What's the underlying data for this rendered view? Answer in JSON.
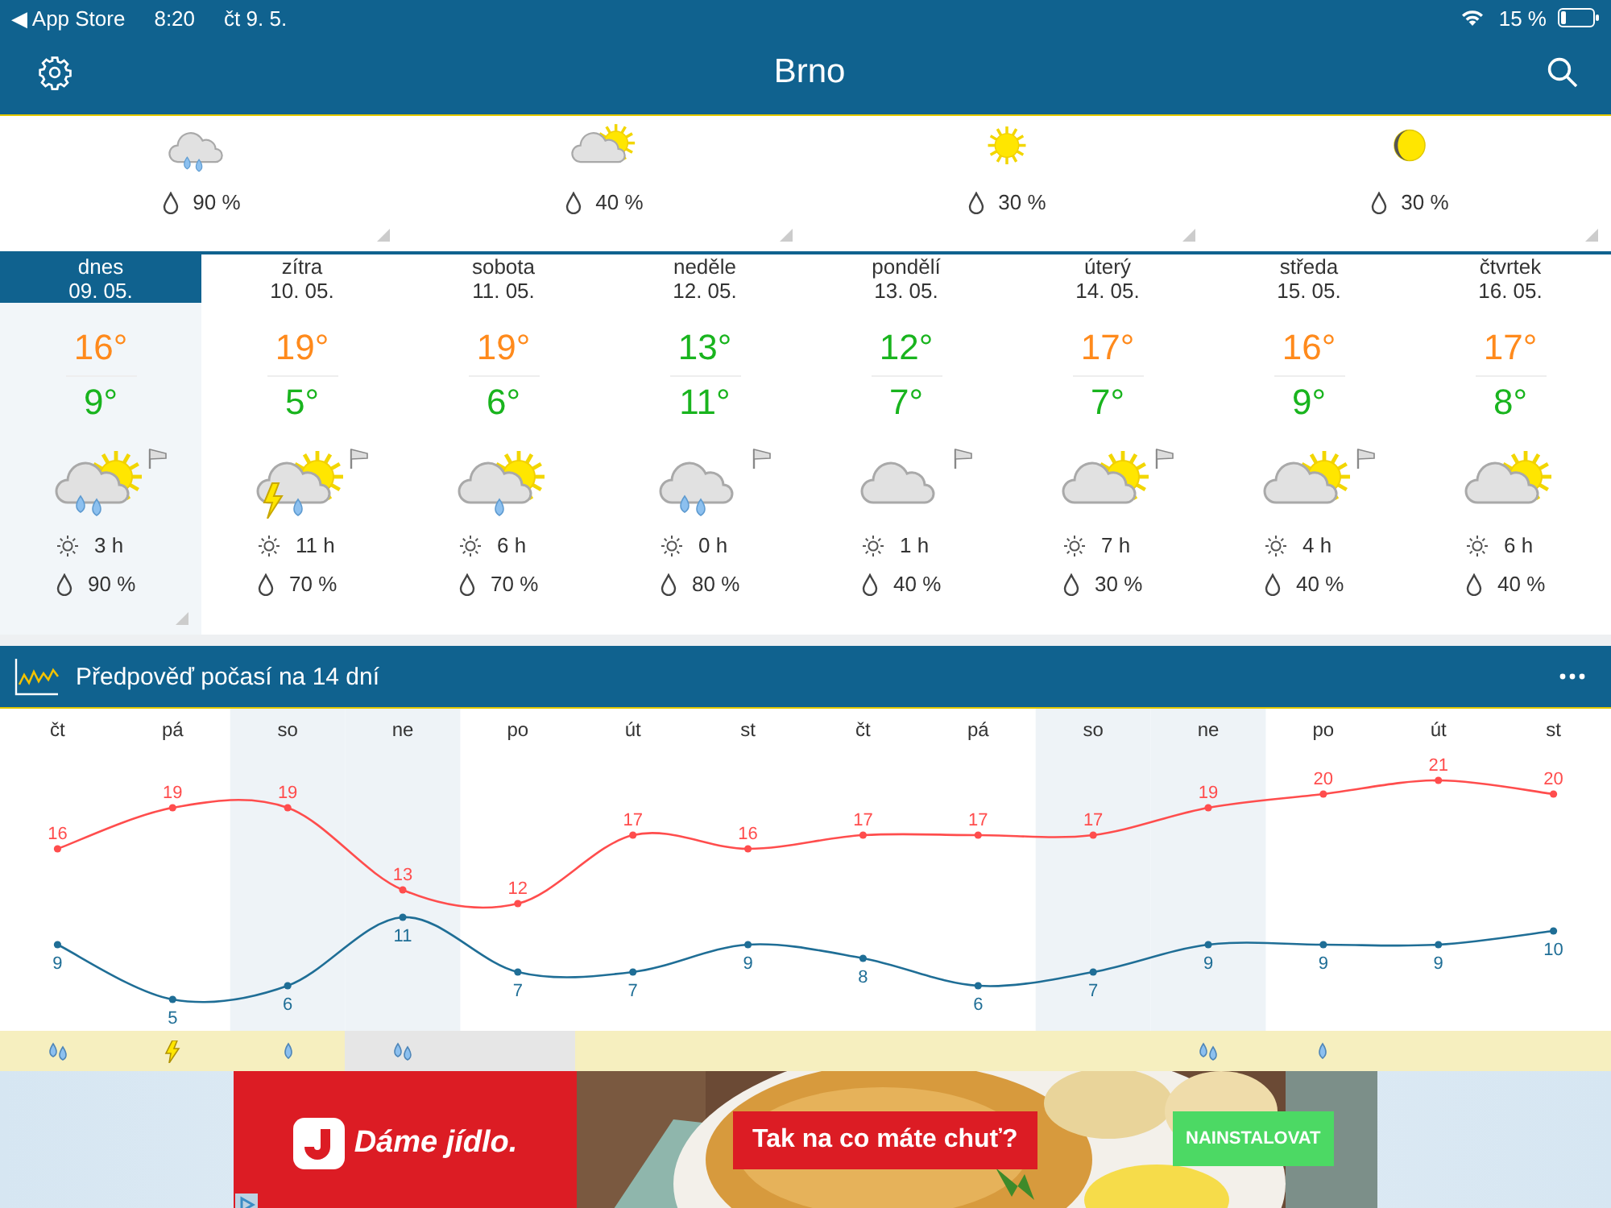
{
  "status_bar": {
    "back_label": "◀ App Store",
    "time": "8:20",
    "date": "čt 9. 5.",
    "battery": "15 %"
  },
  "header": {
    "title": "Brno"
  },
  "hourly": [
    {
      "kind": "rain",
      "precip": "90 %"
    },
    {
      "kind": "partly",
      "precip": "40 %"
    },
    {
      "kind": "sun",
      "precip": "30 %"
    },
    {
      "kind": "moon",
      "precip": "30 %"
    }
  ],
  "days": [
    {
      "name": "dnes",
      "date": "09. 05.",
      "selected": true,
      "high": "16°",
      "color": "#ff8a1c",
      "low": "9°",
      "kind": "rain_sun",
      "windy": true,
      "sun_hours": "3 h",
      "precip": "90 %"
    },
    {
      "name": "zítra",
      "date": "10. 05.",
      "selected": false,
      "high": "19°",
      "color": "#ff8a1c",
      "low": "5°",
      "kind": "storm_sun",
      "windy": true,
      "sun_hours": "11 h",
      "precip": "70 %"
    },
    {
      "name": "sobota",
      "date": "11. 05.",
      "selected": false,
      "high": "19°",
      "color": "#ff8a1c",
      "low": "6°",
      "kind": "drizzle_sun",
      "windy": false,
      "sun_hours": "6 h",
      "precip": "70 %"
    },
    {
      "name": "neděle",
      "date": "12. 05.",
      "selected": false,
      "high": "13°",
      "color": "#19b41e",
      "low": "11°",
      "kind": "rain",
      "windy": true,
      "sun_hours": "0 h",
      "precip": "80 %"
    },
    {
      "name": "pondělí",
      "date": "13. 05.",
      "selected": false,
      "high": "12°",
      "color": "#19b41e",
      "low": "7°",
      "kind": "cloud",
      "windy": true,
      "sun_hours": "1 h",
      "precip": "40 %"
    },
    {
      "name": "úterý",
      "date": "14. 05.",
      "selected": false,
      "high": "17°",
      "color": "#ff8a1c",
      "low": "7°",
      "kind": "partly",
      "windy": true,
      "sun_hours": "7 h",
      "precip": "30 %"
    },
    {
      "name": "středa",
      "date": "15. 05.",
      "selected": false,
      "high": "16°",
      "color": "#ff8a1c",
      "low": "9°",
      "kind": "partly",
      "windy": true,
      "sun_hours": "4 h",
      "precip": "40 %"
    },
    {
      "name": "čtvrtek",
      "date": "16. 05.",
      "selected": false,
      "high": "17°",
      "color": "#ff8a1c",
      "low": "8°",
      "kind": "partly",
      "windy": false,
      "sun_hours": "6 h",
      "precip": "40 %"
    }
  ],
  "forecast": {
    "title": "Předpověď počasí na 14 dní",
    "chart_data": {
      "type": "line",
      "categories": [
        "čt",
        "pá",
        "so",
        "ne",
        "po",
        "út",
        "st",
        "čt",
        "pá",
        "so",
        "ne",
        "po",
        "út",
        "st"
      ],
      "data_labels": true,
      "series": [
        {
          "color": "#ff4d4d",
          "marker": "circle",
          "values": [
            16,
            19,
            19,
            13,
            12,
            17,
            16,
            17,
            17,
            17,
            19,
            20,
            21,
            20
          ]
        },
        {
          "color": "#1f6e96",
          "marker": "circle",
          "values": [
            9,
            5,
            6,
            11,
            7,
            7,
            9,
            8,
            6,
            7,
            9,
            9,
            9,
            10
          ]
        }
      ]
    },
    "weekend": [
      false,
      false,
      true,
      true,
      false,
      false,
      false,
      false,
      false,
      true,
      true,
      false,
      false,
      false
    ],
    "precip_strip": [
      {
        "kind": "rain",
        "color": "#f6efbf"
      },
      {
        "kind": "storm",
        "color": "#f6efbf"
      },
      {
        "kind": "drizzle",
        "color": "#f6efbf"
      },
      {
        "kind": "rain",
        "color": "#e6e6e6"
      },
      {
        "kind": "none",
        "color": "#e6e6e6"
      },
      {
        "kind": "none",
        "color": "#f6efbf"
      },
      {
        "kind": "none",
        "color": "#f6efbf"
      },
      {
        "kind": "none",
        "color": "#f6efbf"
      },
      {
        "kind": "none",
        "color": "#f6efbf"
      },
      {
        "kind": "none",
        "color": "#f6efbf"
      },
      {
        "kind": "rain",
        "color": "#f6efbf"
      },
      {
        "kind": "drizzle",
        "color": "#f6efbf"
      },
      {
        "kind": "none",
        "color": "#f6efbf"
      },
      {
        "kind": "none",
        "color": "#f6efbf"
      }
    ]
  },
  "ad": {
    "brand": "Dáme jídlo.",
    "slogan": "Tak na co máte chuť?",
    "button": "NAINSTALOVAT"
  }
}
